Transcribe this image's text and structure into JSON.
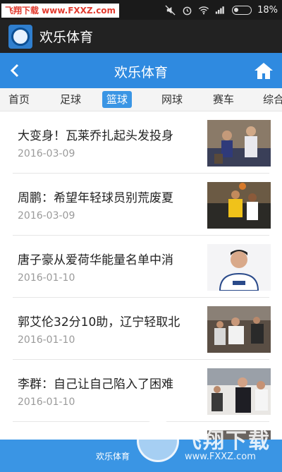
{
  "statusbar": {
    "watermark_text": "飞翔下载 www.FXXZ.com",
    "battery_percent": "18%",
    "icons": [
      "mute-icon",
      "alarm-icon",
      "wifi-icon",
      "signal-icon",
      "battery-icon"
    ]
  },
  "app": {
    "title": "欢乐体育",
    "logo_icon": "soccer-ball-icon"
  },
  "navbar": {
    "title": "欢乐体育",
    "back_icon": "chevron-left-icon",
    "home_icon": "home-icon",
    "color": "#2f8ae0"
  },
  "tabs": [
    {
      "label": "首页",
      "active": false
    },
    {
      "label": "足球",
      "active": false
    },
    {
      "label": "篮球",
      "active": true
    },
    {
      "label": "网球",
      "active": false
    },
    {
      "label": "赛车",
      "active": false
    },
    {
      "label": "综合",
      "active": false
    }
  ],
  "news": [
    {
      "title": "大变身！瓦莱乔扎起头发投身",
      "date": "2016-03-09",
      "thumb": "basketball-players-photo"
    },
    {
      "title": "周鹏：希望年轻球员别荒废夏",
      "date": "2016-03-09",
      "thumb": "basketball-dunk-photo"
    },
    {
      "title": "唐子豪从爱荷华能量名单中消",
      "date": "2016-01-10",
      "thumb": "player-portrait-photo"
    },
    {
      "title": "郭艾伦32分10助，辽宁轻取北",
      "date": "2016-01-10",
      "thumb": "game-action-photo"
    },
    {
      "title": "李群：自己让自己陷入了困难",
      "date": "2016-01-10",
      "thumb": "coach-sideline-photo"
    },
    {
      "title": "",
      "date": "",
      "thumb": "partial-photo"
    }
  ],
  "footer": {
    "text": "欢乐体育",
    "watermark_brand": "飞翔下载",
    "watermark_url": "www.FXXZ.com"
  }
}
